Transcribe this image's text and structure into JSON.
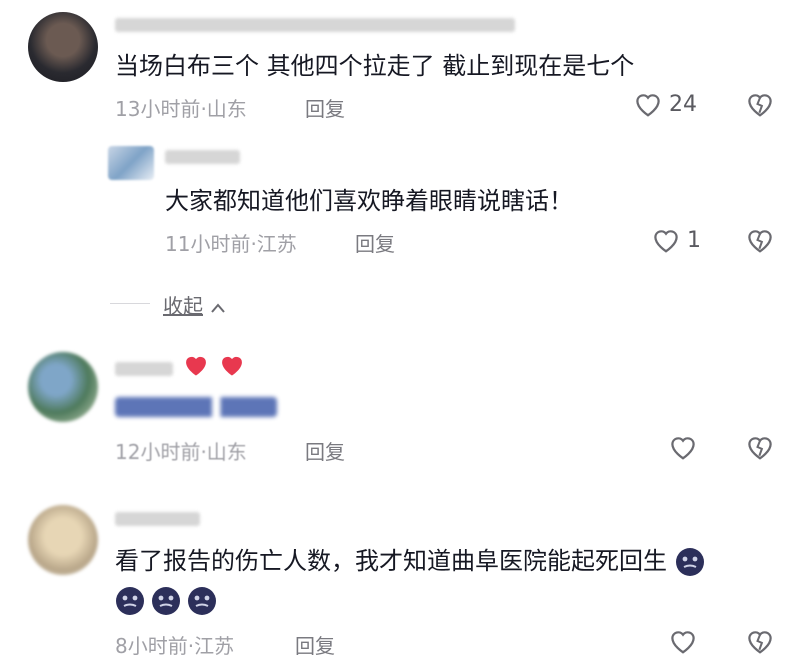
{
  "comments": [
    {
      "text": "当场白布三个   其他四个拉走了    截止到现在是七个",
      "meta": "13小时前·山东",
      "reply": "回复",
      "likes": "24"
    },
    {
      "text": "大家都知道他们喜欢睁着眼睛说瞎话！",
      "meta": "11小时前·江苏",
      "reply": "回复",
      "likes": "1"
    },
    {
      "meta": "12小时前·山东",
      "reply": "回复"
    },
    {
      "text_line1": "看了报告的伤亡人数，我才知道曲阜医院能起死回生",
      "meta": "8小时前·江苏",
      "reply": "回复"
    }
  ],
  "collapse": {
    "label": "收起"
  },
  "colors": {
    "text": "#161823",
    "meta": "#a0a0a6",
    "heart": "#e8384f",
    "emoji": "#2c2f5a"
  }
}
